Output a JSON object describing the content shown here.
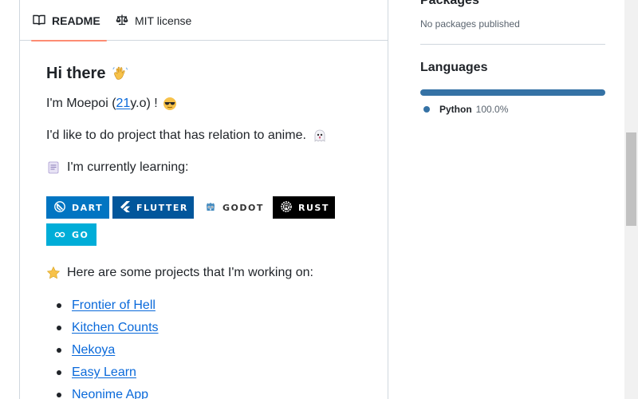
{
  "tabs": {
    "readme": "README",
    "license": "MIT license"
  },
  "readme": {
    "heading": "Hi there",
    "intro_prefix": "I'm Moepoi (",
    "intro_age": "21",
    "intro_suffix": " y.o) !",
    "anime": "I'd like to do project that has relation to anime.",
    "learning": "I'm currently learning:",
    "badges": [
      "DART",
      "FLUTTER",
      "GODOT",
      "RUST",
      "GO"
    ],
    "projects_intro": "Here are some projects that I'm working on:",
    "projects": [
      "Frontier of Hell",
      "Kitchen Counts",
      "Nekoya",
      "Easy Learn",
      "Neonime App"
    ]
  },
  "sidebar": {
    "packages_heading": "Packages",
    "packages_text": "No packages published",
    "languages_title": "Languages",
    "languages": [
      {
        "name": "Python",
        "percent": "100.0%",
        "share": 1.0,
        "color": "#3572a5"
      }
    ]
  },
  "colors": {
    "accent_tab": "#fd8c73",
    "link": "#0969da",
    "dart": "#0175c2",
    "flutter": "#02569b",
    "rust": "#000000",
    "go": "#00add8"
  },
  "icons": [
    "book-icon",
    "law-icon",
    "wave-emoji-icon",
    "sunglasses-emoji-icon",
    "ghost-emoji-icon",
    "scroll-emoji-icon",
    "star-emoji-icon",
    "dart-icon",
    "flutter-icon",
    "godot-icon",
    "rust-icon",
    "go-icon"
  ]
}
